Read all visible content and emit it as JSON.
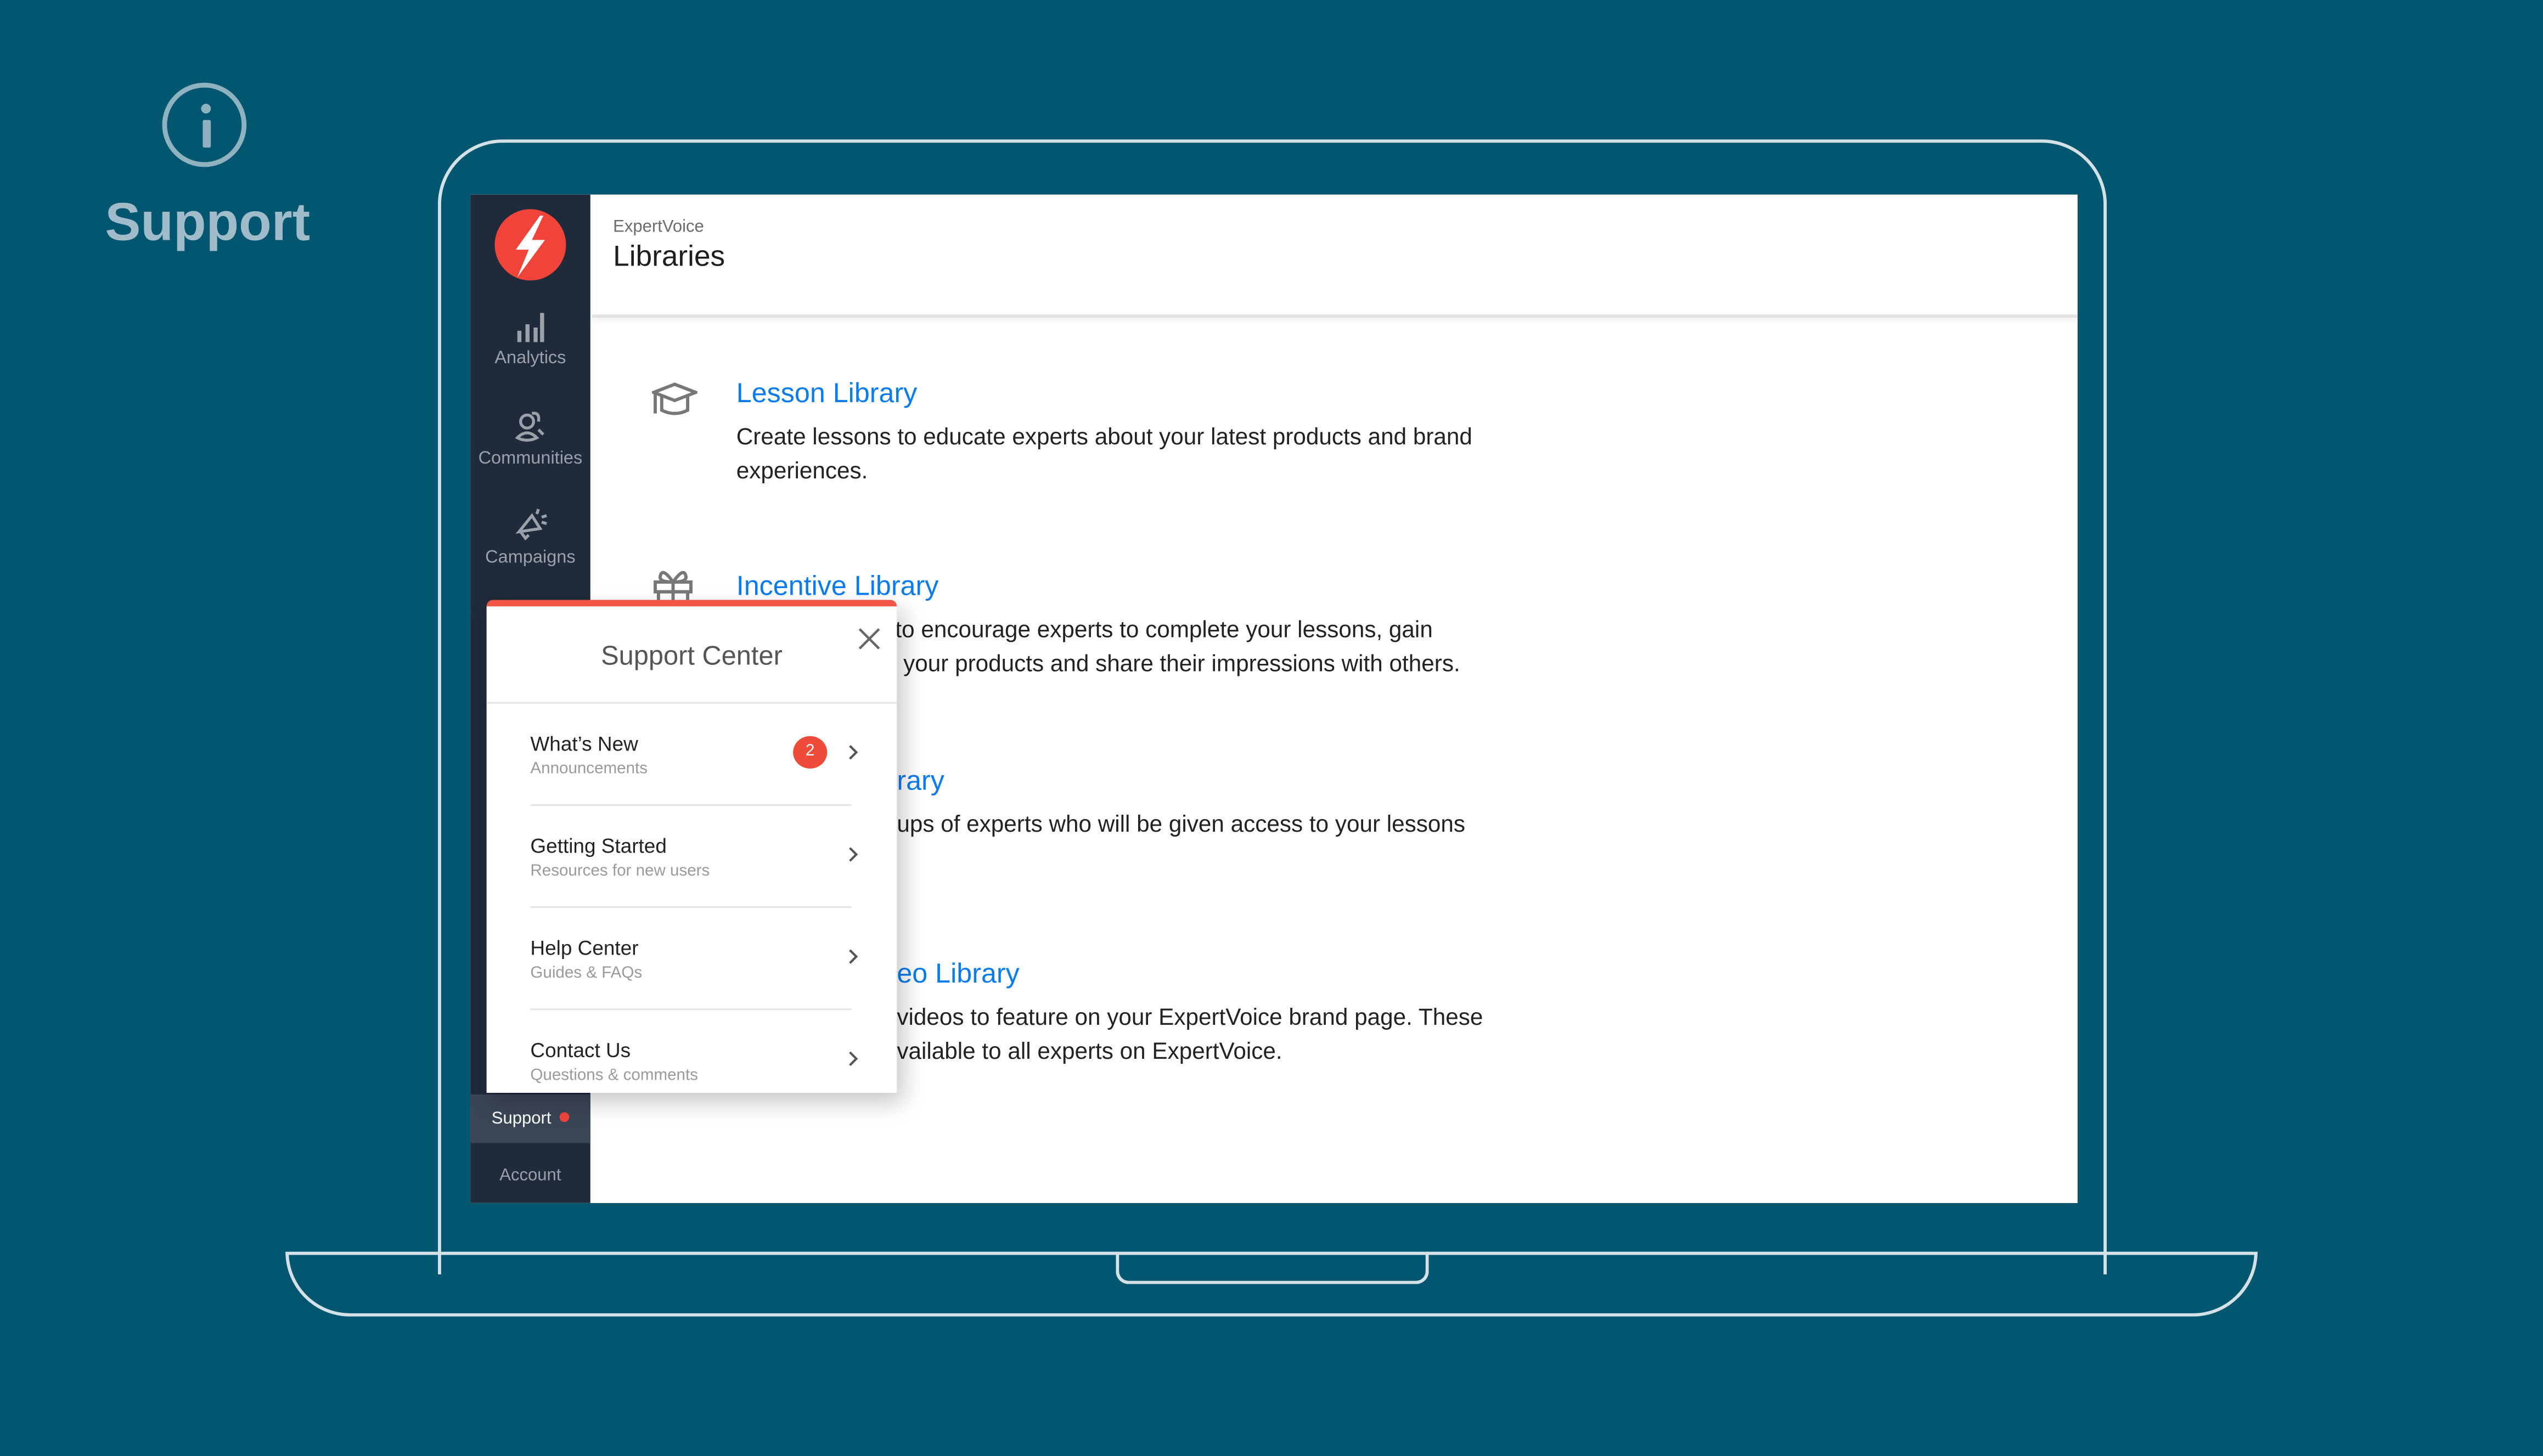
{
  "slide": {
    "label": "Support",
    "icon": "info-icon"
  },
  "app": {
    "breadcrumb": "ExpertVoice",
    "title": "Libraries",
    "sidebar": {
      "items": [
        {
          "label": "Analytics",
          "icon": "bar-chart-icon"
        },
        {
          "label": "Communities",
          "icon": "users-icon"
        },
        {
          "label": "Campaigns",
          "icon": "megaphone-icon"
        },
        {
          "label": "Support",
          "active": true,
          "notification_dot": true
        },
        {
          "label": "Account"
        }
      ]
    },
    "libraries": [
      {
        "title": "Lesson Library",
        "description": "Create lessons to educate experts about your latest products and brand experiences.",
        "icon": "graduation-cap-icon"
      },
      {
        "title": "Incentive Library",
        "description": "to encourage experts to complete your lessons, gain your products and share their impressions with others.",
        "desc_line1": "to encourage experts to complete your lessons, gain",
        "desc_line2": "your products and share their impressions with others.",
        "icon": "gift-icon"
      },
      {
        "title": "rary",
        "description": "ups of experts who will be given access to your lessons"
      },
      {
        "title": "eo Library",
        "desc_line1": "videos to feature on your ExpertVoice brand page. These",
        "desc_line2": "vailable to all experts on ExpertVoice."
      }
    ],
    "support_center": {
      "title": "Support Center",
      "items": [
        {
          "title": "What’s New",
          "subtitle": "Announcements",
          "badge": "2"
        },
        {
          "title": "Getting Started",
          "subtitle": "Resources for new users"
        },
        {
          "title": "Help Center",
          "subtitle": "Guides & FAQs"
        },
        {
          "title": "Contact Us",
          "subtitle": "Questions & comments"
        }
      ]
    }
  },
  "colors": {
    "background": "#03566f",
    "sidebar": "#1f2a3a",
    "accent_red": "#f0443a",
    "link_blue": "#0a7cf0"
  }
}
